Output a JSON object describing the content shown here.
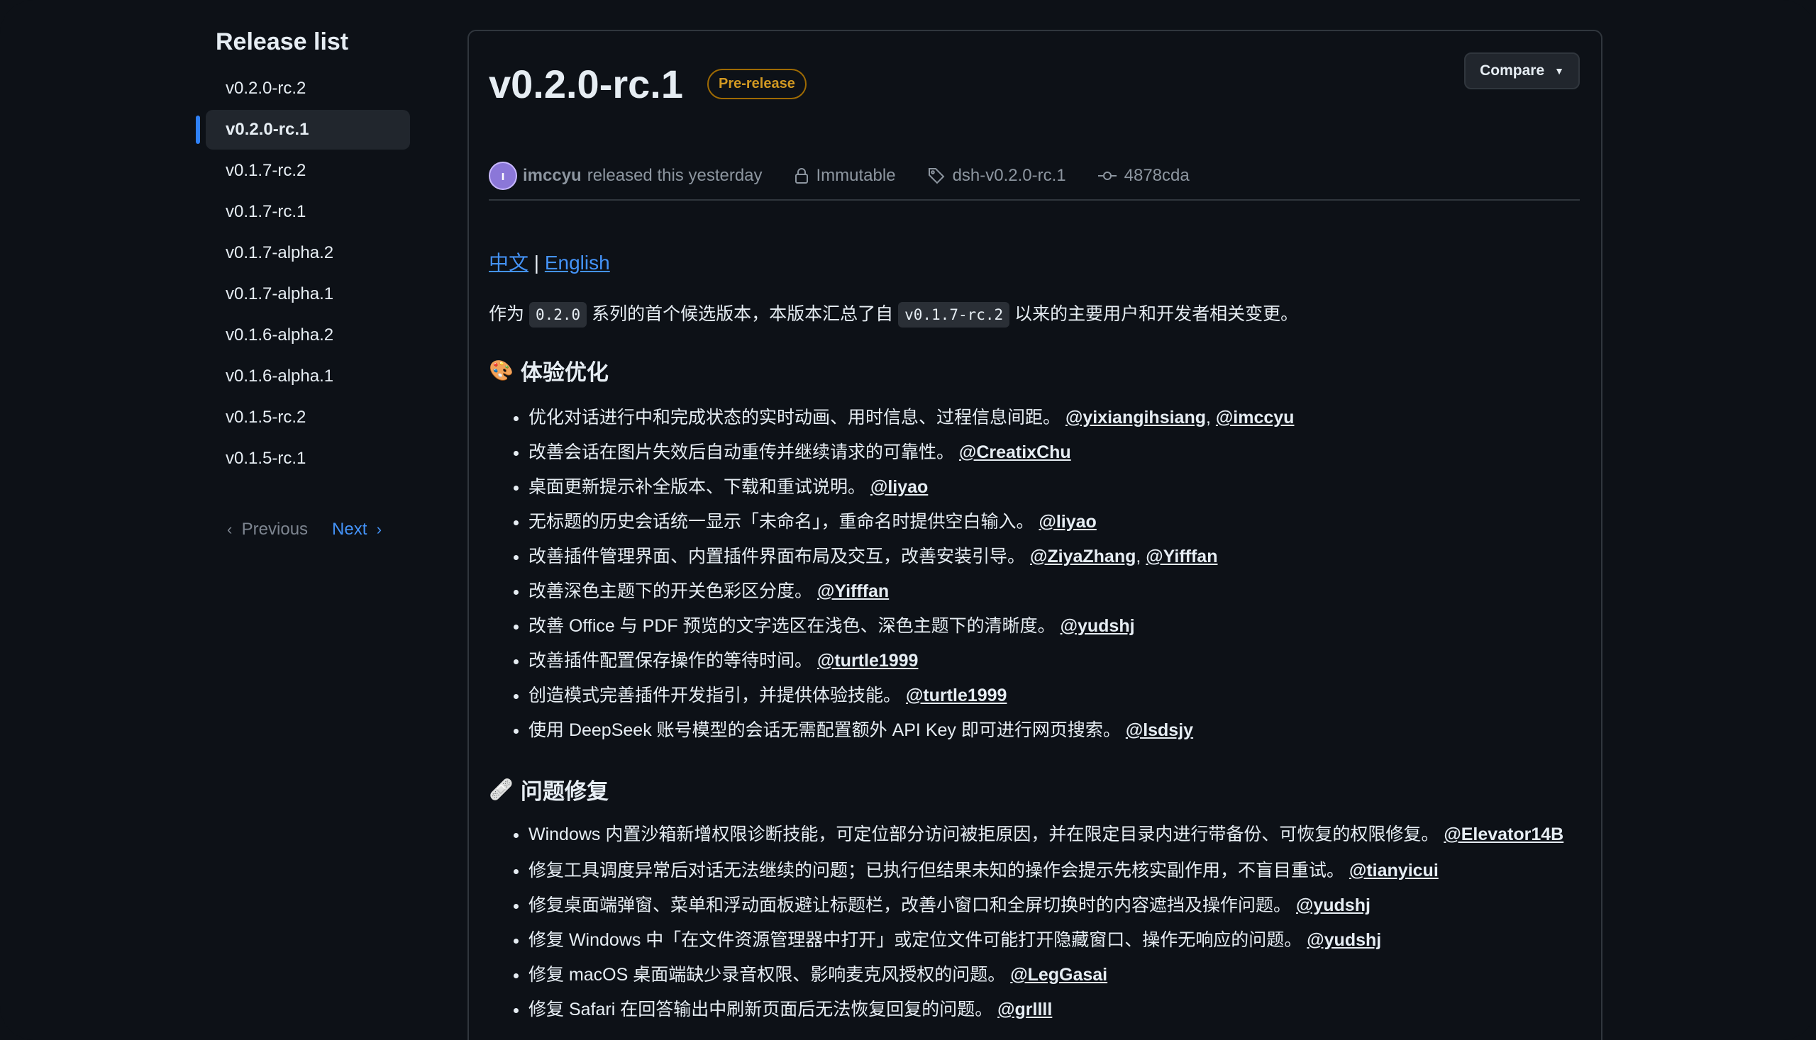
{
  "sidebar": {
    "title": "Release list",
    "items": [
      {
        "label": "v0.2.0-rc.2",
        "active": false
      },
      {
        "label": "v0.2.0-rc.1",
        "active": true
      },
      {
        "label": "v0.1.7-rc.2",
        "active": false
      },
      {
        "label": "v0.1.7-rc.1",
        "active": false
      },
      {
        "label": "v0.1.7-alpha.2",
        "active": false
      },
      {
        "label": "v0.1.7-alpha.1",
        "active": false
      },
      {
        "label": "v0.1.6-alpha.2",
        "active": false
      },
      {
        "label": "v0.1.6-alpha.1",
        "active": false
      },
      {
        "label": "v0.1.5-rc.2",
        "active": false
      },
      {
        "label": "v0.1.5-rc.1",
        "active": false
      }
    ],
    "previous_label": "Previous",
    "next_label": "Next"
  },
  "release": {
    "title": "v0.2.0-rc.1",
    "badge": "Pre-release",
    "compare_label": "Compare",
    "author": "imccyu",
    "released_text": "released this yesterday",
    "immutable_label": "Immutable",
    "tag": "dsh-v0.2.0-rc.1",
    "commit": "4878cda"
  },
  "content": {
    "lang_zh": "中文",
    "lang_sep": "|",
    "lang_en": "English",
    "intro_pre": "作为",
    "intro_code1": "0.2.0",
    "intro_mid": "系列的首个候选版本，本版本汇总了自",
    "intro_code2": "v0.1.7-rc.2",
    "intro_post": "以来的主要用户和开发者相关变更。",
    "sections": [
      {
        "emoji": "🎨",
        "title": "体验优化",
        "items": [
          {
            "text": "优化对话进行中和完成状态的实时动画、用时信息、过程信息间距。",
            "users": [
              "@yixiangihsiang",
              "@imccyu"
            ]
          },
          {
            "text": "改善会话在图片失效后自动重传并继续请求的可靠性。",
            "users": [
              "@CreatixChu"
            ]
          },
          {
            "text": "桌面更新提示补全版本、下载和重试说明。",
            "users": [
              "@liyao"
            ]
          },
          {
            "text": "无标题的历史会话统一显示「未命名」，重命名时提供空白输入。",
            "users": [
              "@liyao"
            ]
          },
          {
            "text": "改善插件管理界面、内置插件界面布局及交互，改善安装引导。",
            "users": [
              "@ZiyaZhang",
              "@Yifffan"
            ]
          },
          {
            "text": "改善深色主题下的开关色彩区分度。",
            "users": [
              "@Yifffan"
            ]
          },
          {
            "text": "改善 Office 与 PDF 预览的文字选区在浅色、深色主题下的清晰度。",
            "users": [
              "@yudshj"
            ]
          },
          {
            "text": "改善插件配置保存操作的等待时间。",
            "users": [
              "@turtle1999"
            ]
          },
          {
            "text": "创造模式完善插件开发指引，并提供体验技能。",
            "users": [
              "@turtle1999"
            ]
          },
          {
            "text": "使用 DeepSeek 账号模型的会话无需配置额外 API Key 即可进行网页搜索。",
            "users": [
              "@lsdsjy"
            ]
          }
        ]
      },
      {
        "emoji": "🩹",
        "title": "问题修复",
        "items": [
          {
            "text": "Windows 内置沙箱新增权限诊断技能，可定位部分访问被拒原因，并在限定目录内进行带备份、可恢复的权限修复。",
            "users": [
              "@Elevator14B"
            ]
          },
          {
            "text": "修复工具调度异常后对话无法继续的问题；已执行但结果未知的操作会提示先核实副作用，不盲目重试。",
            "users": [
              "@tianyicui"
            ]
          },
          {
            "text": "修复桌面端弹窗、菜单和浮动面板避让标题栏，改善小窗口和全屏切换时的内容遮挡及操作问题。",
            "users": [
              "@yudshj"
            ]
          },
          {
            "text": "修复 Windows 中「在文件资源管理器中打开」或定位文件可能打开隐藏窗口、操作无响应的问题。",
            "users": [
              "@yudshj"
            ]
          },
          {
            "text": "修复 macOS 桌面端缺少录音权限、影响麦克风授权的问题。",
            "users": [
              "@LegGasai"
            ]
          },
          {
            "text": "修复 Safari 在回答输出中刷新页面后无法恢复回复的问题。",
            "users": [
              "@grllll"
            ]
          }
        ]
      }
    ]
  },
  "colors": {
    "background": "#0d1117",
    "accent": "#4493f8",
    "badge": "#d29922",
    "border": "#30363d"
  }
}
